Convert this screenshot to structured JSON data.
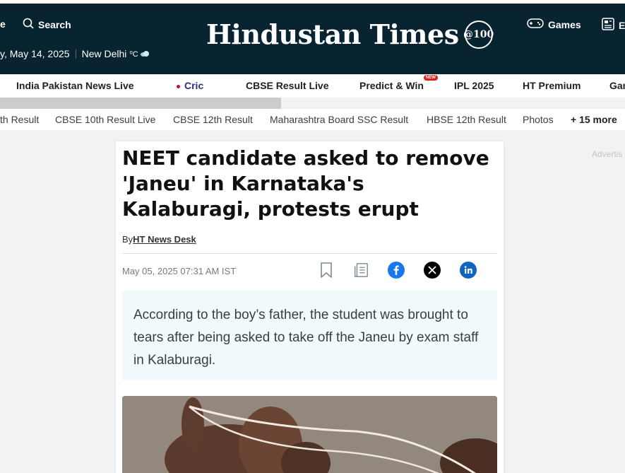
{
  "header": {
    "partial_left_label": "e",
    "search_label": "Search",
    "date_text": "y, May 14, 2025",
    "city_text": "New Delhi",
    "temperature_unit": "⁰C",
    "logo_text": "Hindustan Times",
    "logo_badge": "@100",
    "games_label": "Games",
    "epaper_partial": "E"
  },
  "nav_primary": {
    "items": [
      "India Pakistan News Live",
      "Cric",
      "CBSE Result Live",
      "Predict & Win",
      "IPL 2025",
      "HT Premium",
      "Gam"
    ],
    "new_badge": "NEW"
  },
  "scroll_progress_percent": 45,
  "nav_secondary": {
    "items": [
      "th Result",
      "CBSE 10th Result Live",
      "CBSE 12th Result",
      "Maharashtra Board SSC Result",
      "HBSE 12th Result",
      "Photos"
    ],
    "more_label": "+ 15 more"
  },
  "ad_label": "Advertis",
  "article": {
    "headline": "NEET candidate asked to remove 'Janeu' in Karnataka's Kalaburagi, protests erupt",
    "by_prefix": "By",
    "author": "HT News Desk",
    "published": "May 05, 2025 07:31 AM IST",
    "summary": "According to the boy’s father, the student was brought to tears after being asked to take off the Janeu by exam staff in Kalaburagi."
  },
  "icons": {
    "search": "search-icon",
    "weather": "cloud-icon",
    "games": "gamepad-icon",
    "epaper": "newspaper-icon",
    "bookmark": "bookmark-icon",
    "copy": "copy-icon",
    "facebook": "facebook-icon",
    "x": "x-icon",
    "linkedin": "linkedin-icon"
  },
  "colors": {
    "header_bg": "#092431",
    "facebook": "#1877f2",
    "linkedin": "#0a66c2",
    "summary_bg": "#f1fafd",
    "new_badge": "#e02020"
  }
}
